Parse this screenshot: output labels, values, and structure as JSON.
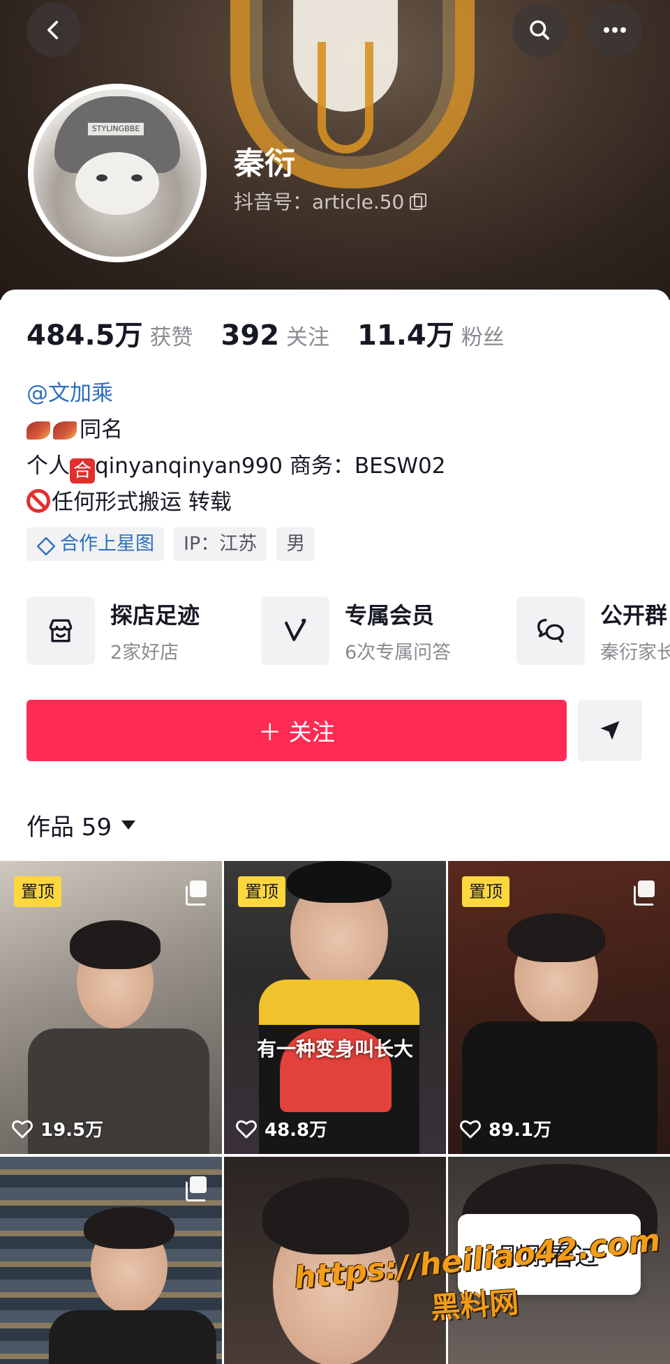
{
  "header": {
    "back_icon": "chevron-left-icon",
    "search_icon": "search-icon",
    "more_icon": "more-horizontal-icon"
  },
  "profile": {
    "name": "秦衍",
    "douyin_id": "抖音号：article.50",
    "avatar_hood_text": "STYLINGBBE"
  },
  "stats": [
    {
      "value": "484.5万",
      "label": "获赞"
    },
    {
      "value": "392",
      "label": "关注"
    },
    {
      "value": "11.4万",
      "label": "粉丝"
    }
  ],
  "bio": {
    "mention": "@文加乘",
    "line2": "同名",
    "line3_prefix": "个人",
    "line3_badge": "合",
    "line3_rest": "qinyanqinyan990  商务：BESW02",
    "line4": "任何形式搬运 转载"
  },
  "tags": [
    {
      "label": "合作上星图"
    },
    {
      "label": "IP：江苏"
    },
    {
      "label": "男"
    }
  ],
  "services": [
    {
      "title": "探店足迹",
      "sub": "2家好店"
    },
    {
      "title": "专属会员",
      "sub": "6次专属问答"
    },
    {
      "title": "公开群",
      "sub": "秦衍家长"
    }
  ],
  "actions": {
    "follow_label": "＋ 关注"
  },
  "works": {
    "tab_label": "作品 59"
  },
  "videos": [
    {
      "pinned": "置顶",
      "likes": "19.5万",
      "caption": ""
    },
    {
      "pinned": "置顶",
      "likes": "48.8万",
      "caption": "有一种变身叫长大"
    },
    {
      "pinned": "置顶",
      "likes": "89.1万",
      "caption": ""
    }
  ],
  "recently_viewed": "刚刚看过",
  "watermark": {
    "line1": "https://heiliao42.com",
    "line2": "黑料网"
  },
  "colors": {
    "accent": "#fe2c55",
    "pin": "#fdd83d",
    "link": "#2b6fbe"
  }
}
